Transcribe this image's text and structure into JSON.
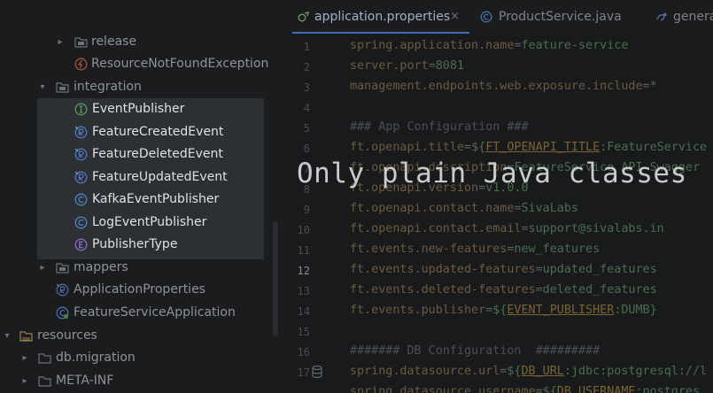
{
  "tree": {
    "items": [
      {
        "label": "release",
        "icon": "folder-icon"
      },
      {
        "label": "ResourceNotFoundException",
        "icon": "exception-icon"
      },
      {
        "label": "integration",
        "icon": "folder-icon"
      },
      {
        "label": "EventPublisher",
        "icon": "interface-icon"
      },
      {
        "label": "FeatureCreatedEvent",
        "icon": "record-icon"
      },
      {
        "label": "FeatureDeletedEvent",
        "icon": "record-icon"
      },
      {
        "label": "FeatureUpdatedEvent",
        "icon": "record-icon"
      },
      {
        "label": "KafkaEventPublisher",
        "icon": "class-icon"
      },
      {
        "label": "LogEventPublisher",
        "icon": "class-icon"
      },
      {
        "label": "PublisherType",
        "icon": "enum-icon"
      },
      {
        "label": "mappers",
        "icon": "folder-icon"
      },
      {
        "label": "ApplicationProperties",
        "icon": "record-icon"
      },
      {
        "label": "FeatureServiceApplication",
        "icon": "spring-class-icon"
      },
      {
        "label": "resources",
        "icon": "resources-folder-icon"
      },
      {
        "label": "db.migration",
        "icon": "folder-icon"
      },
      {
        "label": "META-INF",
        "icon": "folder-icon"
      }
    ]
  },
  "tabs": [
    {
      "label": "application.properties",
      "active": true
    },
    {
      "label": "ProductService.java",
      "active": false
    },
    {
      "label": "genera",
      "active": false
    }
  ],
  "tab_close_glyph": "×",
  "editor": {
    "line_numbers": [
      "1",
      "2",
      "3",
      "4",
      "5",
      "6",
      "7",
      "8",
      "9",
      "10",
      "11",
      "12",
      "13",
      "14",
      "15",
      "16",
      "17"
    ],
    "current_line": "12",
    "lines": {
      "l1_key": "spring.application.name",
      "l1_val": "feature-service",
      "l2_key": "server.port",
      "l2_val": "8081",
      "l3_key": "management.endpoints.web.exposure.include",
      "l3_val": "*",
      "l5_comment": "### App Configuration ###",
      "l6_key": "ft.openapi.title",
      "l6_pre": "${",
      "l6_var": "FT_OPENAPI_TITLE",
      "l6_rest": ":FeatureService",
      "l7_key": "ft.openapi.description",
      "l7_val": "FeatureService API Swagger",
      "l8_key": "ft.openapi.version",
      "l8_val": "v1.0.0",
      "l9_key": "ft.openapi.contact.name",
      "l9_val": "SivaLabs",
      "l10_key": "ft.openapi.contact.email",
      "l10_val": "support@sivalabs.in",
      "l11_key": "ft.events.new-features",
      "l11_val": "new_features",
      "l12_key": "ft.events.updated-features",
      "l12_val": "updated_features",
      "l13_key": "ft.events.deleted-features",
      "l13_val": "deleted_features",
      "l14_key": "ft.events.publisher",
      "l14_pre": "${",
      "l14_var": "EVENT_PUBLISHER",
      "l14_rest": ":DUMB}",
      "l16_comment": "####### DB Configuration  #########",
      "l17_key": "spring.datasource.url",
      "l17_pre": "${",
      "l17_var": "DB_URL",
      "l17_rest": ":jdbc:postgresql://l",
      "l18_key": "spring.datasource.username",
      "l18_pre": "${",
      "l18_var": "DB_USERNAME",
      "l18_rest": ":postgres"
    },
    "equals": "="
  },
  "overlay_text": "Only plain Java classes",
  "colors": {
    "background": "#1b1c1e",
    "selection": "#2c2f33",
    "accent": "#3d6fb0"
  }
}
